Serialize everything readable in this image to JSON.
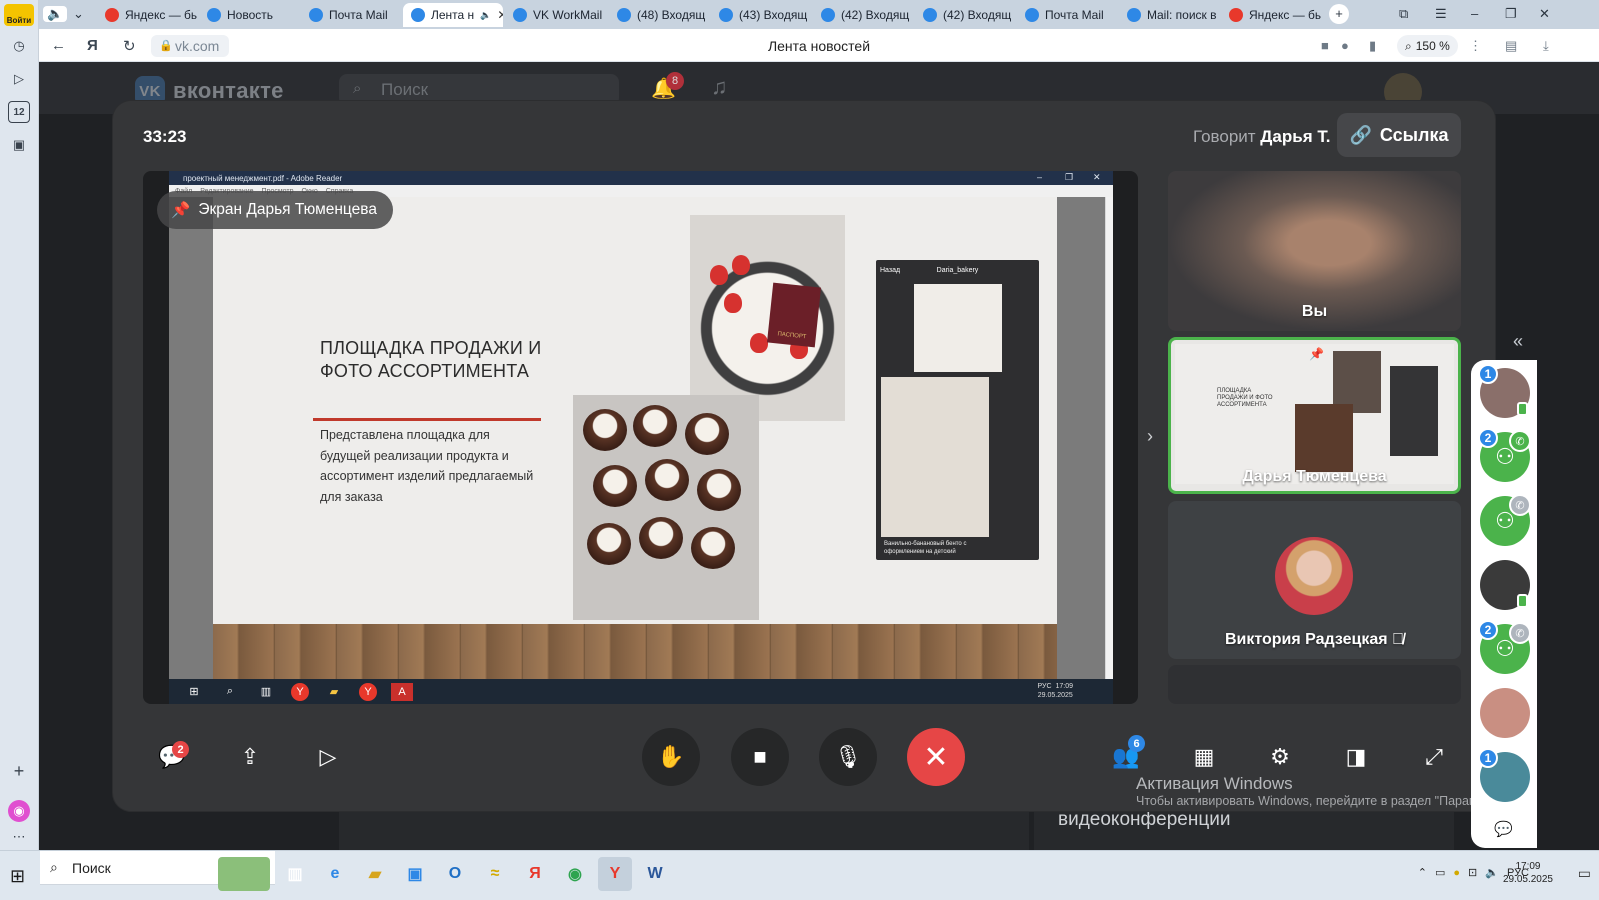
{
  "browser": {
    "login_label": "Войти",
    "tabs": [
      {
        "label": "Яндекс — бы",
        "icon": "yandex-icon",
        "color": "#e8382b",
        "active": false
      },
      {
        "label": "Новость",
        "icon": "mail-at-icon",
        "color": "#2e88e6",
        "active": false
      },
      {
        "label": "Почта Mail",
        "icon": "mail-envelope-icon",
        "color": "#2e88e6",
        "active": false
      },
      {
        "label": "Лента н",
        "icon": "vk-icon",
        "color": "#2e88e6",
        "active": true
      },
      {
        "label": "VK WorkMail",
        "icon": "vk-workmail-icon",
        "color": "#2e88e6",
        "active": false
      },
      {
        "label": "(48) Входящ",
        "icon": "mail-envelope-icon",
        "color": "#2e88e6",
        "active": false
      },
      {
        "label": "(43) Входящ",
        "icon": "mail-envelope-icon",
        "color": "#2e88e6",
        "active": false
      },
      {
        "label": "(42) Входящ",
        "icon": "mail-envelope-icon",
        "color": "#2e88e6",
        "active": false
      },
      {
        "label": "(42) Входящ",
        "icon": "vk-workmail-icon",
        "color": "#2e88e6",
        "active": false
      },
      {
        "label": "Почта Mail",
        "icon": "mail-envelope-icon",
        "color": "#2e88e6",
        "active": false
      },
      {
        "label": "Mail: поиск в",
        "icon": "mail-at-icon",
        "color": "#2e88e6",
        "active": false
      },
      {
        "label": "Яндекс — бы",
        "icon": "yandex-icon",
        "color": "#e8382b",
        "active": false
      }
    ],
    "url": "vk.com",
    "page_title": "Лента новостей",
    "zoom": "150 %",
    "sidebar_counter": "12"
  },
  "vk": {
    "logo_text": "вконтакте",
    "search_placeholder": "Поиск",
    "notifications_count": "8",
    "bottom_text": "видеоконференции"
  },
  "call": {
    "timer": "33:23",
    "speaking_label": "Говорит",
    "speaking_name": "Дарья Т.",
    "link_label": "Ссылка",
    "screen_share_label": "Экран Дарья Тюменцева",
    "shared_screen": {
      "window_title": "проектный менеджмент.pdf - Adobe Reader",
      "menu": [
        "Файл",
        "Редактирование",
        "Просмотр",
        "Окно",
        "Справка"
      ],
      "slide_title": "ПЛОЩАДКА ПРОДАЖИ И ФОТО АССОРТИМЕНТА",
      "slide_body": "Представлена площадка для будущей реализации продукта и ассортимент изделий предлагаемый для заказа",
      "passport_text": "ПАСПОРТ",
      "phone_back": "Назад",
      "phone_profile": "Daria_bakery",
      "phone_caption": "Ванильно-банановый бенто с оформлением на детский",
      "taskbar_lang": "РУС",
      "taskbar_time": "17:09",
      "taskbar_date": "29.05.2025"
    },
    "participants": [
      {
        "name": "Вы"
      },
      {
        "name": "Дарья Тюменцева"
      },
      {
        "name": "Виктория Радзецкая"
      }
    ],
    "mini_slide_title": "ПЛОЩАДКА ПРОДАЖИ И ФОТО АССОРТИМЕНТА",
    "controls": {
      "chat_badge": "2",
      "participants_badge": "6"
    },
    "windows_watermark_title": "Активация Windows",
    "windows_watermark_text": "Чтобы активировать Windows, перейдите в раздел \"Параметры\"."
  },
  "call_strip": {
    "items": [
      {
        "badge": "1",
        "kind": "avatar",
        "status": "online"
      },
      {
        "badge": "2",
        "kind": "group",
        "status": "phone-green"
      },
      {
        "badge": "",
        "kind": "group",
        "status": "phone-gray"
      },
      {
        "badge": "",
        "kind": "avatar",
        "status": "online"
      },
      {
        "badge": "2",
        "kind": "group",
        "status": "phone-gray"
      },
      {
        "badge": "",
        "kind": "avatar",
        "status": ""
      },
      {
        "badge": "1",
        "kind": "avatar",
        "status": ""
      }
    ]
  },
  "taskbar": {
    "search_label": "Поиск",
    "lang": "РУС",
    "time": "17:09",
    "date": "29.05.2025"
  }
}
